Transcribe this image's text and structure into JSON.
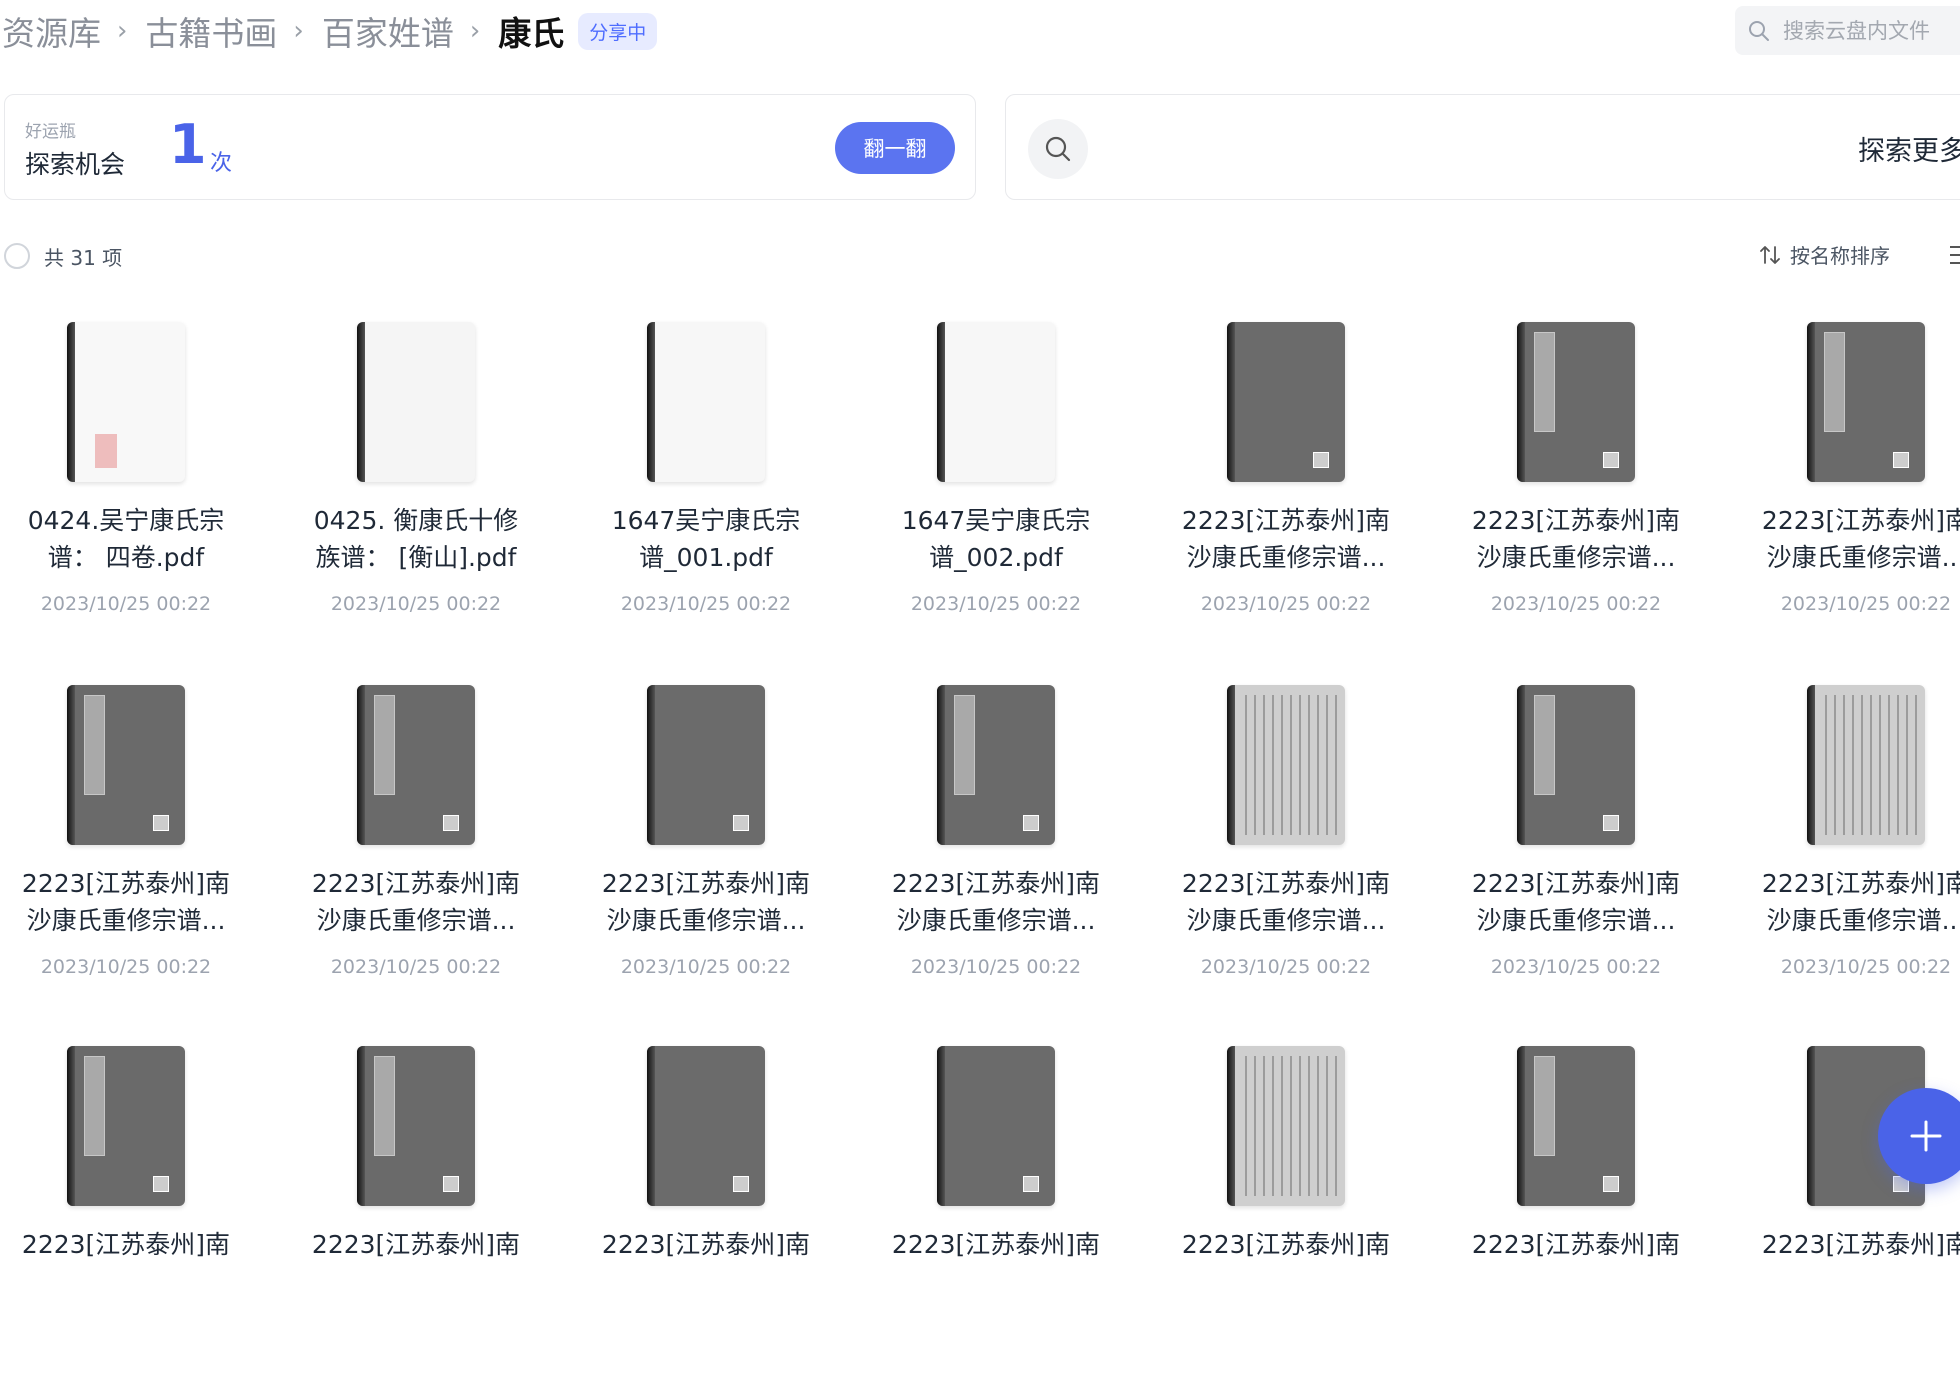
{
  "breadcrumb": {
    "items": [
      "资源库",
      "古籍书画",
      "百家姓谱"
    ],
    "current": "康氏",
    "badge": "分享中",
    "separator": "›"
  },
  "search": {
    "placeholder": "搜索云盘内文件"
  },
  "luck": {
    "small_label": "好运瓶",
    "label": "探索机会",
    "count": "1",
    "unit": "次",
    "button": "翻一翻"
  },
  "explore": {
    "label": "探索更多"
  },
  "list": {
    "count_label": "共 31 项",
    "sort_label": "按名称排序"
  },
  "files": [
    {
      "line1": "0424.吴宁康氏宗",
      "line2": "谱： 四卷.pdf",
      "date": "2023/10/25 00:22",
      "thumb": "blank-seal"
    },
    {
      "line1": "0425. 衡康氏十修",
      "line2": "族谱： [衡山].pdf",
      "date": "2023/10/25 00:22",
      "thumb": "blank-faint"
    },
    {
      "line1": "1647吴宁康氏宗",
      "line2": "谱_001.pdf",
      "date": "2023/10/25 00:22",
      "thumb": "blank"
    },
    {
      "line1": "1647吴宁康氏宗",
      "line2": "谱_002.pdf",
      "date": "2023/10/25 00:22",
      "thumb": "blank"
    },
    {
      "line1": "2223[江苏泰州]南",
      "line2": "沙康氏重修宗谱...",
      "date": "2023/10/25 00:22",
      "thumb": "cover-plain"
    },
    {
      "line1": "2223[江苏泰州]南",
      "line2": "沙康氏重修宗谱...",
      "date": "2023/10/25 00:22",
      "thumb": "cover-label"
    },
    {
      "line1": "2223[江苏泰州]南",
      "line2": "沙康氏重修宗谱...",
      "date": "2023/10/25 00:22",
      "thumb": "cover-label"
    },
    {
      "line1": "2223[江苏泰州]南",
      "line2": "沙康氏重修宗谱...",
      "date": "2023/10/25 00:22",
      "thumb": "cover-label"
    },
    {
      "line1": "2223[江苏泰州]南",
      "line2": "沙康氏重修宗谱...",
      "date": "2023/10/25 00:22",
      "thumb": "cover-label"
    },
    {
      "line1": "2223[江苏泰州]南",
      "line2": "沙康氏重修宗谱...",
      "date": "2023/10/25 00:22",
      "thumb": "cover-plain"
    },
    {
      "line1": "2223[江苏泰州]南",
      "line2": "沙康氏重修宗谱...",
      "date": "2023/10/25 00:22",
      "thumb": "cover-label"
    },
    {
      "line1": "2223[江苏泰州]南",
      "line2": "沙康氏重修宗谱...",
      "date": "2023/10/25 00:22",
      "thumb": "page-text"
    },
    {
      "line1": "2223[江苏泰州]南",
      "line2": "沙康氏重修宗谱...",
      "date": "2023/10/25 00:22",
      "thumb": "cover-label"
    },
    {
      "line1": "2223[江苏泰州]南",
      "line2": "沙康氏重修宗谱...",
      "date": "2023/10/25 00:22",
      "thumb": "page-text"
    },
    {
      "line1": "2223[江苏泰州]南",
      "line2": "",
      "date": "",
      "thumb": "cover-label"
    },
    {
      "line1": "2223[江苏泰州]南",
      "line2": "",
      "date": "",
      "thumb": "cover-label"
    },
    {
      "line1": "2223[江苏泰州]南",
      "line2": "",
      "date": "",
      "thumb": "cover-plain"
    },
    {
      "line1": "2223[江苏泰州]南",
      "line2": "",
      "date": "",
      "thumb": "cover-plain"
    },
    {
      "line1": "2223[江苏泰州]南",
      "line2": "",
      "date": "",
      "thumb": "page-text"
    },
    {
      "line1": "2223[江苏泰州]南",
      "line2": "",
      "date": "",
      "thumb": "cover-label"
    },
    {
      "line1": "2223[江苏泰州]南",
      "line2": "",
      "date": "",
      "thumb": "cover-plain"
    }
  ],
  "icons": {
    "search": "search-icon",
    "explore": "search-icon",
    "sort": "sort-arrows-icon",
    "view": "list-view-icon",
    "add": "plus-icon"
  },
  "colors": {
    "accent": "#4a63e8",
    "badge_bg": "#e7ebff"
  }
}
